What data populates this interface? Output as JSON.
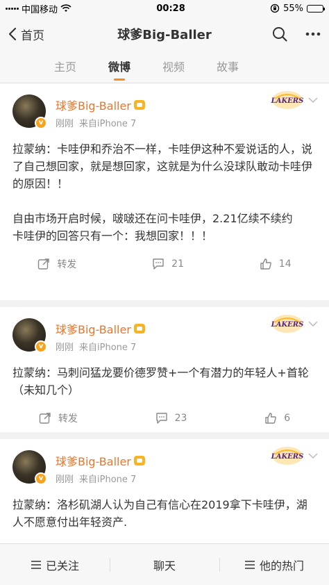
{
  "status_bar": {
    "carrier": "中国移动",
    "time": "00:28",
    "battery": "55%",
    "battery_level": 0.55
  },
  "nav": {
    "back_label": "首页",
    "title": "球爹Big-Baller",
    "search_icon": "search-icon",
    "more_icon": "more-icon"
  },
  "tabs": [
    {
      "label": "主页",
      "active": false
    },
    {
      "label": "微博",
      "active": true
    },
    {
      "label": "视频",
      "active": false
    },
    {
      "label": "故事",
      "active": false
    }
  ],
  "posts": [
    {
      "author": "球爹Big-Baller",
      "time": "刚刚",
      "source": "来自iPhone 7",
      "text": "拉蒙纳：卡哇伊和乔治不一样，卡哇伊这种不爱说话的人，说了自己想回家，就是想回家，这就是为什么没球队敢动卡哇伊的原因！！\n\n自由市场开启时候，啵啵还在问卡哇伊，2.21亿续不续约\n卡哇伊的回答只有一个：我想回家！！！",
      "repost_label": "转发",
      "comments": "21",
      "likes": "14"
    },
    {
      "author": "球爹Big-Baller",
      "time": "刚刚",
      "source": "来自iPhone 7",
      "text": "拉蒙纳：马刺问猛龙要价德罗赞+一个有潜力的年轻人+首轮（未知几个）",
      "repost_label": "转发",
      "comments": "23",
      "likes": "6"
    },
    {
      "author": "球爹Big-Baller",
      "time": "刚刚",
      "source": "来自iPhone 7",
      "text": "拉蒙纳：洛杉矶湖人认为自己有信心在2019拿下卡哇伊，湖人不愿意付出年轻资产.",
      "repost_label": "",
      "comments": "",
      "likes": ""
    }
  ],
  "logo_text": "LAKERS",
  "bottom_bar": {
    "follow_label": "已关注",
    "chat_label": "聊天",
    "hot_label": "他的热门"
  },
  "colors": {
    "accent": "#f78b1e",
    "author_name": "#e8752a",
    "lakers_purple": "#552583",
    "lakers_gold": "#fdb927"
  }
}
